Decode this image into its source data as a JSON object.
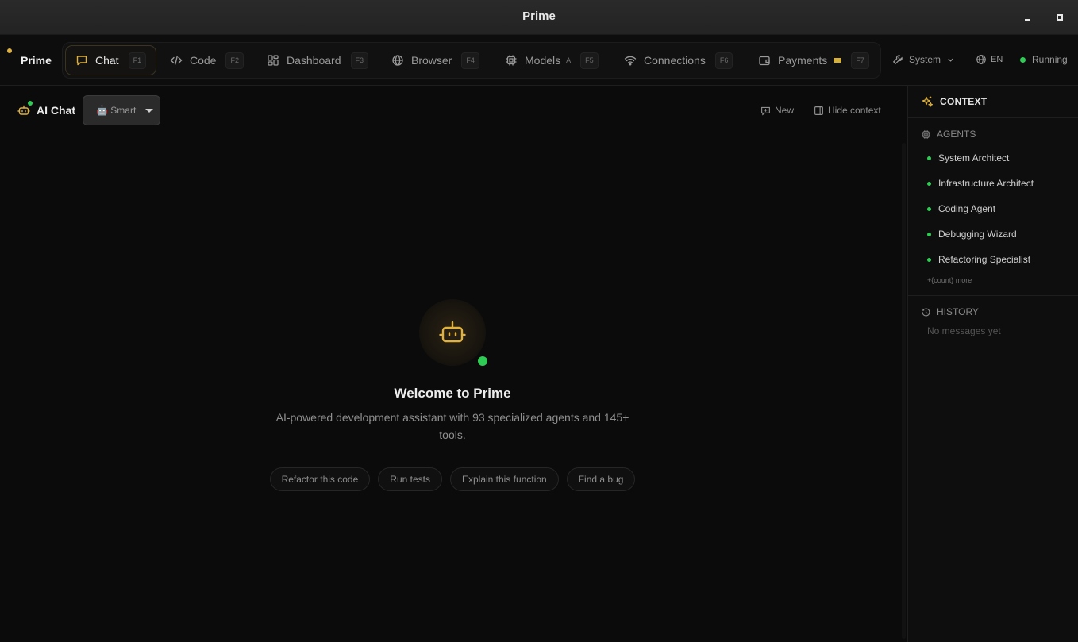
{
  "window": {
    "title": "Prime"
  },
  "nav": {
    "brand": "Prime",
    "tabs": [
      {
        "label": "Chat",
        "key": "F1",
        "icon": "chat-bubble-icon",
        "active": true
      },
      {
        "label": "Code",
        "key": "F2",
        "icon": "code-icon"
      },
      {
        "label": "Dashboard",
        "key": "F3",
        "icon": "dashboard-grid-icon"
      },
      {
        "label": "Browser",
        "key": "F4",
        "icon": "globe-icon"
      },
      {
        "label": "Models",
        "key": "F5",
        "icon": "cpu-chip-icon",
        "badge": "A"
      },
      {
        "label": "Connections",
        "key": "F6",
        "icon": "wifi-icon"
      },
      {
        "label": "Payments",
        "key": "F7",
        "icon": "wallet-icon"
      }
    ],
    "system_label": "System",
    "language": "EN",
    "status": "Running"
  },
  "chat": {
    "title": "AI Chat",
    "mode": "🤖 Smart",
    "new_label": "New",
    "hide_context_label": "Hide context"
  },
  "welcome": {
    "title": "Welcome to Prime",
    "subtitle": "AI-powered development assistant with 93 specialized agents and 145+ tools.",
    "suggestions": [
      "Refactor this code",
      "Run tests",
      "Explain this function",
      "Find a bug"
    ]
  },
  "context": {
    "title": "CONTEXT",
    "agents_title": "AGENTS",
    "agents": [
      "System Architect",
      "Infrastructure Architect",
      "Coding Agent",
      "Debugging Wizard",
      "Refactoring Specialist"
    ],
    "more": "+{count} more",
    "history_title": "HISTORY",
    "history_empty": "No messages yet"
  },
  "colors": {
    "accent": "#e0b13c",
    "status_green": "#2ecc55",
    "background": "#0b0b0b"
  }
}
